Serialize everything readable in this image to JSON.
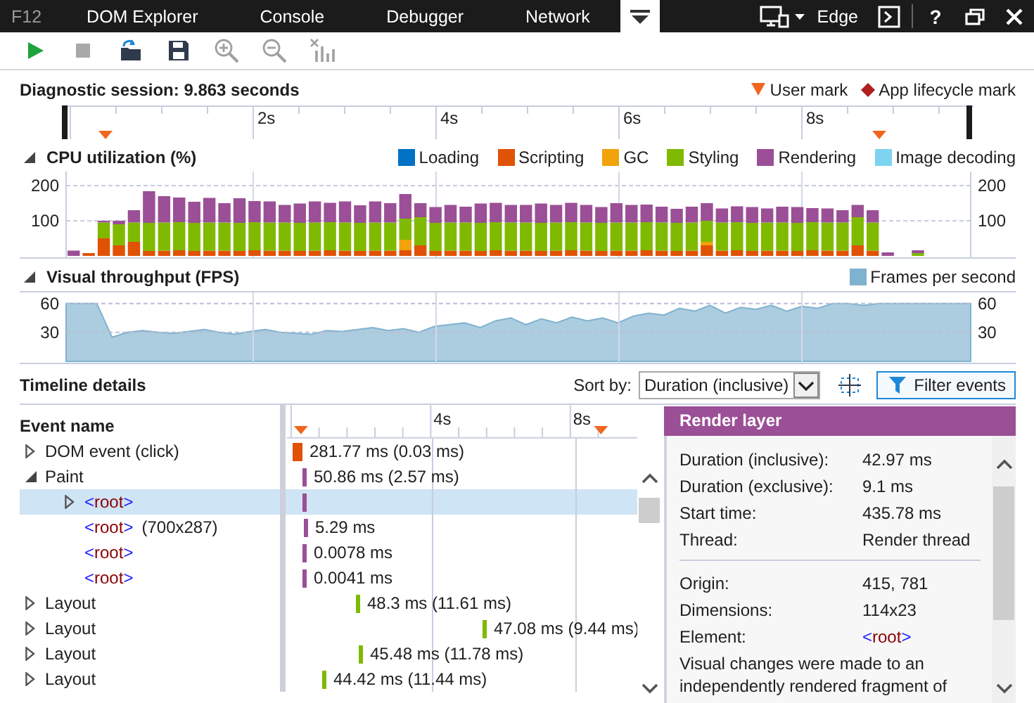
{
  "top_bar": {
    "app_label": "F12",
    "tabs": [
      {
        "kind": "text",
        "label": "DOM Explorer",
        "selected": false
      },
      {
        "kind": "text",
        "label": "Console",
        "selected": false
      },
      {
        "kind": "text",
        "label": "Debugger",
        "selected": false
      },
      {
        "kind": "text",
        "label": "Network",
        "selected": false
      },
      {
        "kind": "menu",
        "selected": true
      }
    ],
    "target": "Edge",
    "help_label": "?"
  },
  "toolbar": [
    {
      "kind": "start",
      "disabled": false
    },
    {
      "kind": "stop",
      "disabled": true
    },
    {
      "kind": "import",
      "disabled": false
    },
    {
      "kind": "save",
      "disabled": false
    },
    {
      "kind": "zoom_in",
      "disabled": true
    },
    {
      "kind": "zoom_out",
      "disabled": true
    },
    {
      "kind": "clear_selection",
      "disabled": true
    }
  ],
  "session": {
    "title": "Diagnostic session: 9.863 seconds",
    "legend": [
      {
        "kind": "user",
        "label": "User mark"
      },
      {
        "kind": "lifecycle",
        "label": "App lifecycle mark"
      }
    ],
    "ruler": [
      "2s",
      "4s",
      "6s",
      "8s"
    ]
  },
  "cpu": {
    "title": "CPU utilization (%)",
    "expanded": true,
    "right_axis_labels": [
      "200",
      "100"
    ],
    "chart_data": {
      "type": "bar",
      "stacked": true,
      "grid": true,
      "ylim": [
        0,
        240
      ],
      "yticks": [
        100,
        200
      ],
      "series": [
        {
          "name": "Loading",
          "color": "#0072c6",
          "values": [
            0,
            0,
            0,
            0,
            0,
            0,
            0,
            0,
            0,
            0,
            0,
            0,
            0,
            0,
            0,
            0,
            0,
            0,
            0,
            0,
            0,
            0,
            0,
            0,
            0,
            0,
            0,
            0,
            0,
            0,
            0,
            0,
            0,
            0,
            0,
            0,
            0,
            0,
            0,
            0,
            0,
            0,
            0,
            0,
            0,
            0,
            0,
            0,
            0,
            0,
            0,
            0,
            0,
            0,
            0,
            0,
            0,
            0,
            0,
            0
          ]
        },
        {
          "name": "Scripting",
          "color": "#e05206",
          "values": [
            0,
            8,
            50,
            30,
            40,
            14,
            15,
            16,
            14,
            15,
            15,
            14,
            16,
            15,
            15,
            14,
            15,
            16,
            15,
            14,
            15,
            15,
            16,
            30,
            14,
            15,
            15,
            14,
            16,
            15,
            15,
            14,
            15,
            16,
            15,
            14,
            15,
            15,
            16,
            15,
            14,
            15,
            30,
            15,
            16,
            14,
            15,
            15,
            14,
            16,
            15,
            15,
            30,
            15,
            0,
            0,
            0,
            0,
            0,
            0
          ]
        },
        {
          "name": "GC",
          "color": "#f0a30a",
          "values": [
            0,
            0,
            0,
            0,
            0,
            0,
            0,
            0,
            0,
            0,
            0,
            0,
            0,
            0,
            0,
            0,
            0,
            0,
            0,
            0,
            0,
            0,
            30,
            0,
            0,
            0,
            0,
            0,
            0,
            0,
            0,
            0,
            0,
            0,
            0,
            0,
            0,
            0,
            0,
            0,
            0,
            0,
            10,
            0,
            0,
            0,
            0,
            0,
            0,
            0,
            0,
            0,
            0,
            0,
            0,
            0,
            0,
            0,
            0,
            0
          ]
        },
        {
          "name": "Styling",
          "color": "#7fba00",
          "values": [
            0,
            0,
            45,
            60,
            55,
            80,
            80,
            80,
            80,
            80,
            80,
            80,
            80,
            80,
            80,
            80,
            80,
            80,
            80,
            80,
            80,
            80,
            60,
            80,
            80,
            80,
            80,
            80,
            80,
            80,
            80,
            80,
            80,
            80,
            80,
            80,
            80,
            80,
            80,
            80,
            80,
            80,
            60,
            80,
            80,
            80,
            80,
            80,
            80,
            80,
            80,
            80,
            80,
            80,
            0,
            0,
            8,
            0,
            0,
            0
          ]
        },
        {
          "name": "Rendering",
          "color": "#9b4f96",
          "values": [
            15,
            0,
            5,
            10,
            35,
            90,
            75,
            70,
            60,
            70,
            55,
            70,
            60,
            60,
            50,
            55,
            60,
            55,
            60,
            50,
            60,
            55,
            70,
            40,
            45,
            50,
            45,
            55,
            55,
            50,
            50,
            55,
            50,
            55,
            50,
            45,
            55,
            50,
            50,
            45,
            40,
            45,
            50,
            40,
            45,
            45,
            40,
            45,
            45,
            40,
            40,
            35,
            35,
            35,
            10,
            0,
            8,
            0,
            0,
            0
          ]
        },
        {
          "name": "Image decoding",
          "color": "#7dd3f0",
          "values": [
            0,
            0,
            0,
            0,
            0,
            0,
            0,
            0,
            0,
            0,
            0,
            0,
            0,
            0,
            0,
            0,
            0,
            0,
            0,
            0,
            0,
            0,
            0,
            0,
            0,
            0,
            0,
            0,
            0,
            0,
            0,
            0,
            0,
            0,
            0,
            0,
            0,
            0,
            0,
            0,
            0,
            0,
            0,
            0,
            0,
            0,
            0,
            0,
            0,
            0,
            0,
            0,
            0,
            0,
            0,
            0,
            0,
            0,
            0,
            0
          ]
        }
      ]
    }
  },
  "fps": {
    "title": "Visual throughput (FPS)",
    "expanded": true,
    "right_axis_labels": [
      "60",
      "30"
    ],
    "chart_data": {
      "type": "area",
      "grid": true,
      "ylim": [
        0,
        70
      ],
      "yticks": [
        30,
        60
      ],
      "series": [
        {
          "name": "Frames per second",
          "color": "#7fb2cf",
          "values": [
            60,
            60,
            60,
            25,
            30,
            32,
            30,
            29,
            31,
            33,
            30,
            28,
            31,
            33,
            30,
            29,
            28,
            32,
            31,
            33,
            35,
            32,
            34,
            30,
            36,
            38,
            40,
            35,
            42,
            45,
            38,
            44,
            40,
            46,
            42,
            45,
            40,
            47,
            50,
            48,
            55,
            52,
            58,
            50,
            56,
            54,
            58,
            52,
            57,
            55,
            60,
            60,
            58,
            60,
            60,
            60,
            60,
            60,
            60,
            60
          ]
        }
      ]
    }
  },
  "timeline": {
    "title": "Timeline details",
    "sort_label": "Sort by:",
    "sort_value": "Duration (inclusive)",
    "filter_button": "Filter events",
    "column": "Event name",
    "ruler": [
      "4s",
      "8s"
    ],
    "events": [
      {
        "name": "DOM event (click)",
        "expandable": true,
        "expanded": false,
        "color": "#e05206",
        "duration": "281.77 ms (0.03 ms)",
        "selected": false
      },
      {
        "name": "Paint",
        "expandable": true,
        "expanded": true,
        "color": "#9b4f96",
        "duration": "50.86 ms (2.57 ms)",
        "selected": false,
        "children": [
          {
            "tag": {
              "open": "<",
              "name": "root",
              "close": ">"
            },
            "expandable": true,
            "expanded": false,
            "color": "#9b4f96",
            "selected": true
          },
          {
            "tag": {
              "open": "<",
              "name": "root",
              "close": ">"
            },
            "name": "(700x287)",
            "expandable": false,
            "color": "#9b4f96",
            "duration": "5.29 ms",
            "selected": false
          },
          {
            "tag": {
              "open": "<",
              "name": "root",
              "close": ">"
            },
            "expandable": false,
            "color": "#9b4f96",
            "duration": "0.0078 ms",
            "selected": false
          },
          {
            "tag": {
              "open": "<",
              "name": "root",
              "close": ">"
            },
            "expandable": false,
            "color": "#9b4f96",
            "duration": "0.0041 ms",
            "selected": false
          }
        ]
      },
      {
        "name": "Layout",
        "expandable": true,
        "expanded": false,
        "color": "#7fba00",
        "duration": "48.3 ms (11.61 ms)",
        "selected": false
      },
      {
        "name": "Layout",
        "expandable": true,
        "expanded": false,
        "color": "#7fba00",
        "duration": "47.08 ms (9.44 ms)",
        "selected": false
      },
      {
        "name": "Layout",
        "expandable": true,
        "expanded": false,
        "color": "#7fba00",
        "duration": "45.48 ms (11.78 ms)",
        "selected": false
      },
      {
        "name": "Layout",
        "expandable": true,
        "expanded": false,
        "color": "#7fba00",
        "duration": "44.42 ms (11.44 ms)",
        "selected": false
      }
    ]
  },
  "details": {
    "title": "Render layer",
    "groups": [
      [
        {
          "label": "Duration (inclusive):",
          "value": "42.97 ms"
        },
        {
          "label": "Duration (exclusive):",
          "value": "9.1 ms"
        },
        {
          "label": "Start time:",
          "value": "435.78 ms"
        },
        {
          "label": "Thread:",
          "value": "Render thread"
        }
      ],
      [
        {
          "label": "Origin:",
          "value": "415, 781"
        },
        {
          "label": "Dimensions:",
          "value": "114x23"
        },
        {
          "label": "Element:",
          "tag": {
            "open": "<",
            "name": "root",
            "close": ">"
          }
        }
      ]
    ],
    "description": "Visual changes were made to an independently rendered fragment of"
  }
}
